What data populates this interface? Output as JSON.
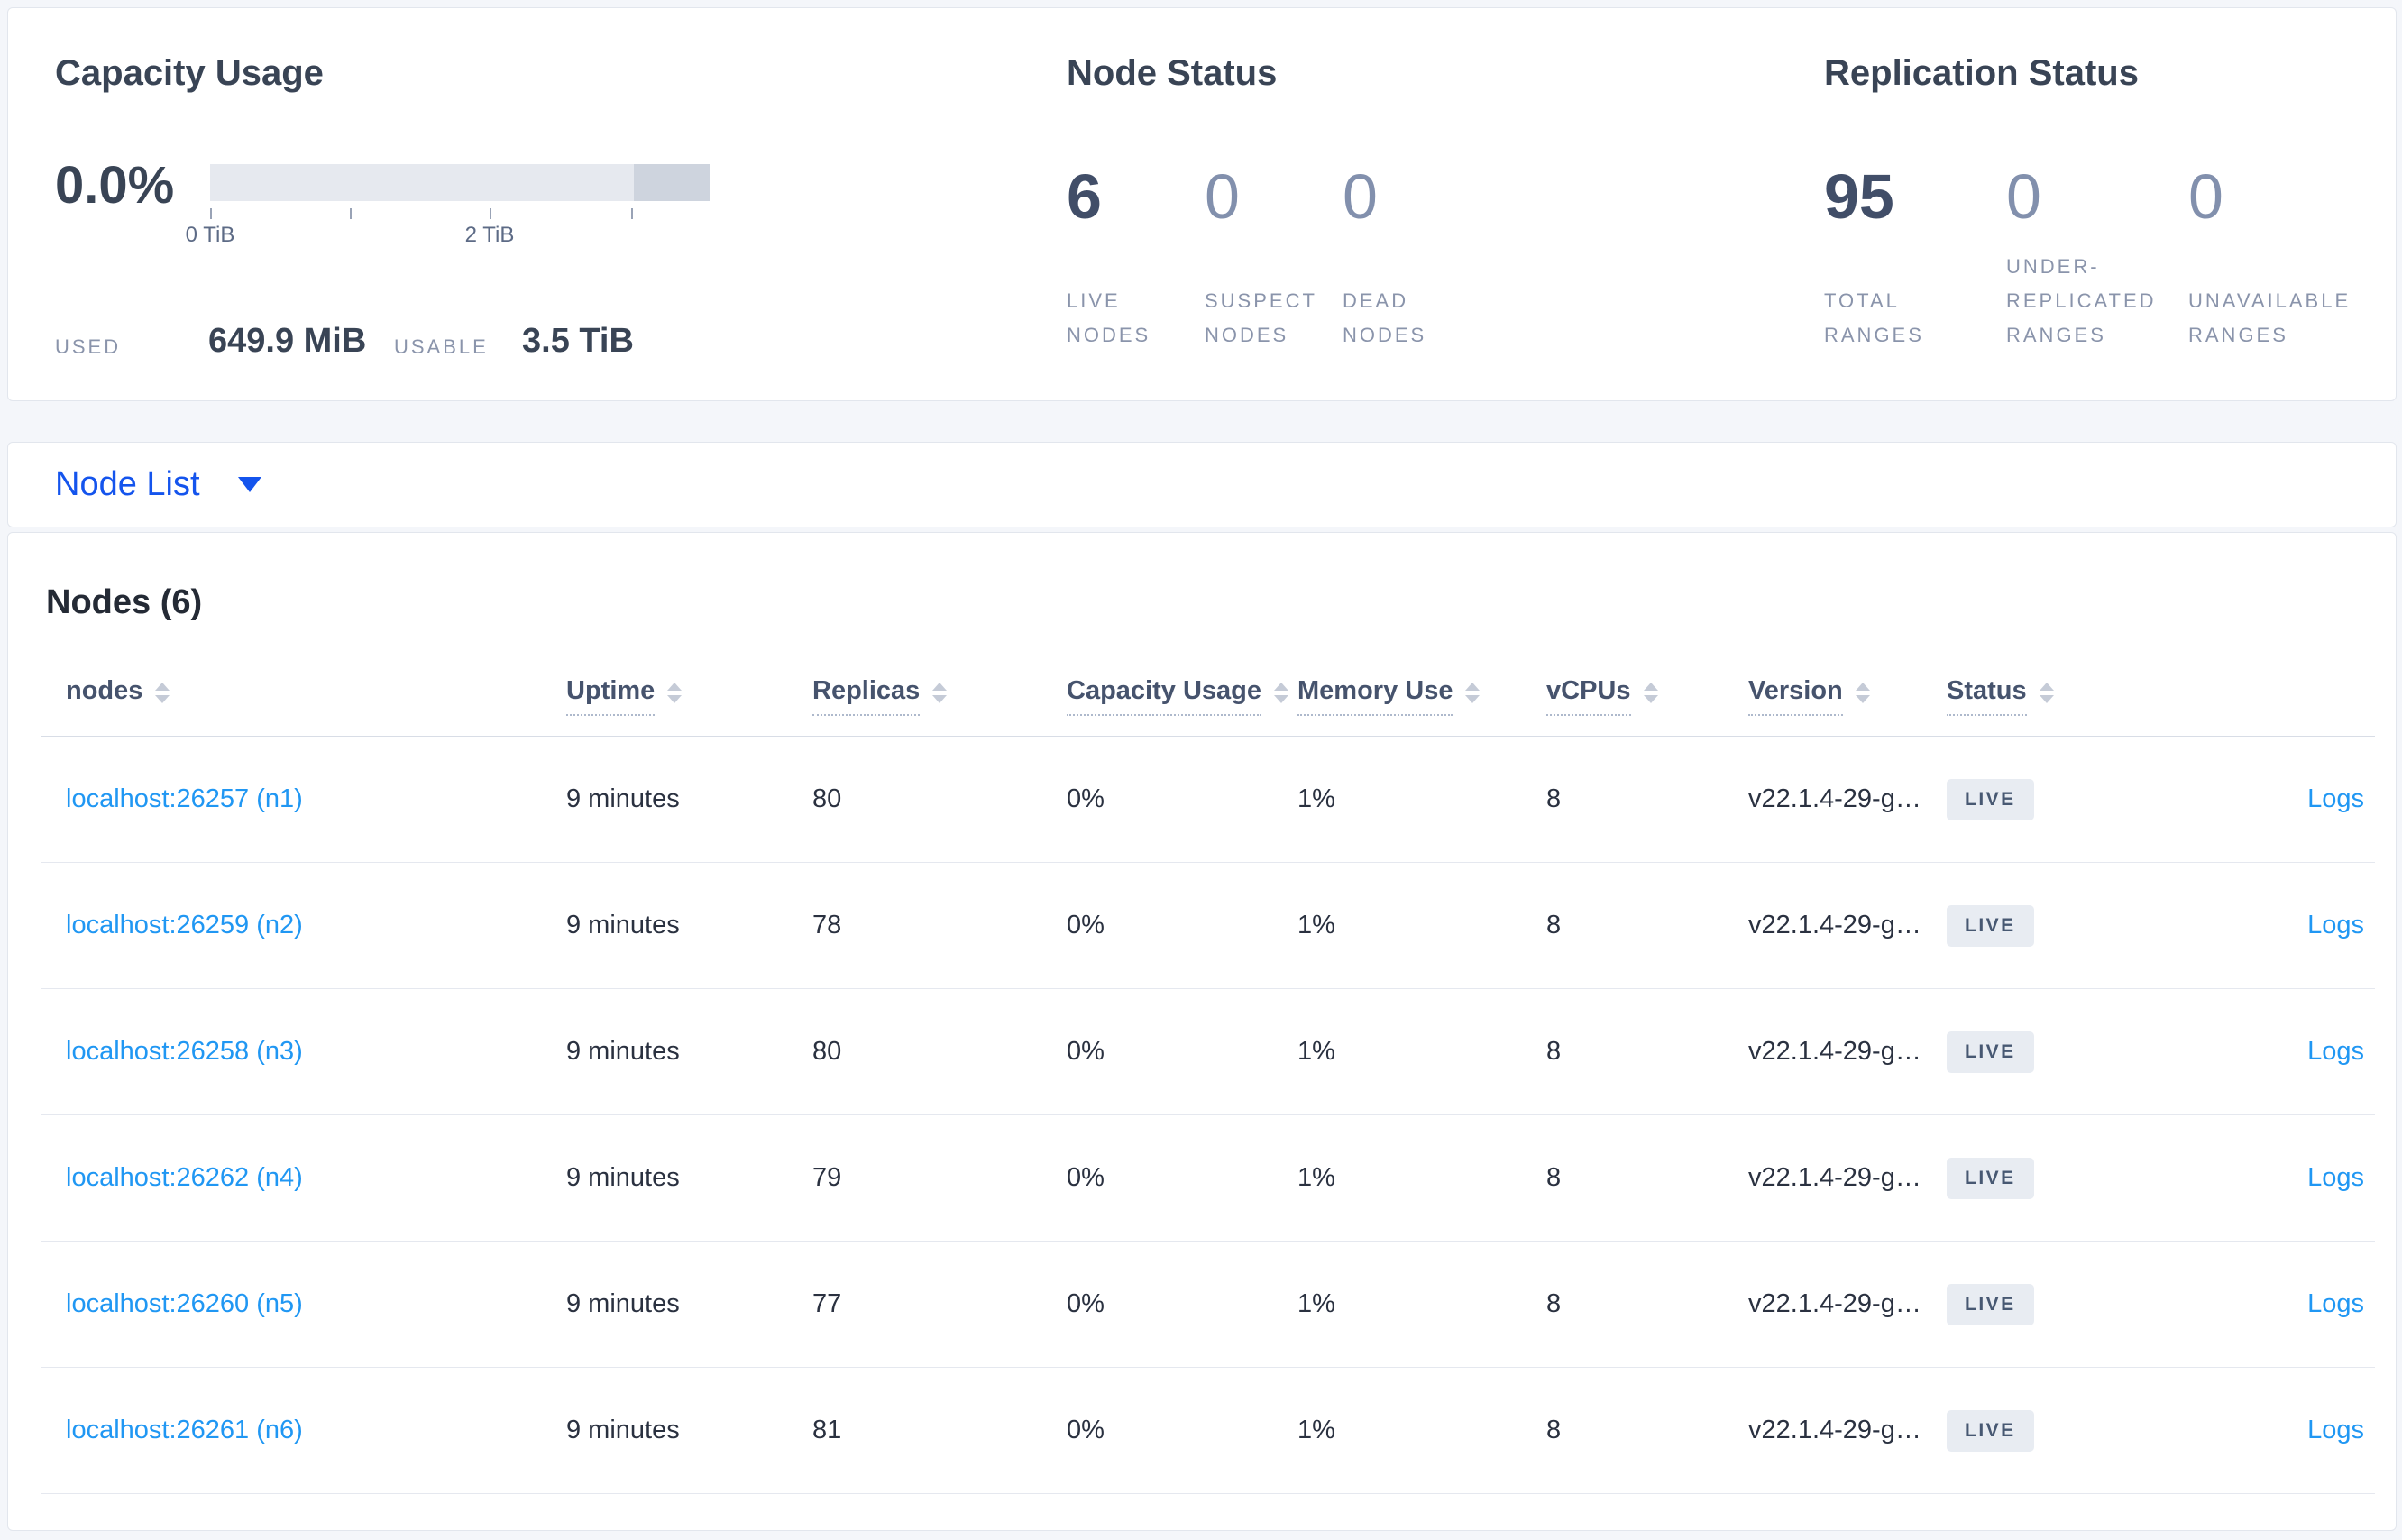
{
  "summary": {
    "capacity": {
      "title": "Capacity Usage",
      "percent": "0.0%",
      "axis_tick_labels": [
        "0 TiB",
        "",
        "2 TiB",
        ""
      ],
      "used_label": "USED",
      "used_value": "649.9 MiB",
      "usable_label": "USABLE",
      "usable_value": "3.5 TiB"
    },
    "node_status": {
      "title": "Node Status",
      "stats": [
        {
          "value": "6",
          "label": "LIVE NODES",
          "emphasis": "strong"
        },
        {
          "value": "0",
          "label": "SUSPECT NODES",
          "emphasis": "muted"
        },
        {
          "value": "0",
          "label": "DEAD NODES",
          "emphasis": "muted"
        }
      ]
    },
    "replication": {
      "title": "Replication Status",
      "stats": [
        {
          "value": "95",
          "label": "TOTAL RANGES",
          "emphasis": "strong"
        },
        {
          "value": "0",
          "label": "UNDER-REPLICATED RANGES",
          "emphasis": "muted"
        },
        {
          "value": "0",
          "label": "UNAVAILABLE RANGES",
          "emphasis": "muted"
        }
      ]
    }
  },
  "node_list_dropdown": {
    "label": "Node List"
  },
  "nodes_table": {
    "title": "Nodes (6)",
    "columns": [
      {
        "label": "nodes",
        "underline": false,
        "sortable": true
      },
      {
        "label": "Uptime",
        "underline": true,
        "sortable": true
      },
      {
        "label": "Replicas",
        "underline": true,
        "sortable": true
      },
      {
        "label": "Capacity Usage",
        "underline": true,
        "sortable": true
      },
      {
        "label": "Memory Use",
        "underline": true,
        "sortable": true
      },
      {
        "label": "vCPUs",
        "underline": true,
        "sortable": true
      },
      {
        "label": "Version",
        "underline": true,
        "sortable": true
      },
      {
        "label": "Status",
        "underline": true,
        "sortable": true
      },
      {
        "label": "",
        "underline": false,
        "sortable": false
      }
    ],
    "rows": [
      {
        "address": "localhost:26257 (n1)",
        "uptime": "9 minutes",
        "replicas": "80",
        "capacity_usage": "0%",
        "memory_use": "1%",
        "vcpus": "8",
        "version": "v22.1.4-29-g…",
        "status": "LIVE",
        "logs": "Logs"
      },
      {
        "address": "localhost:26259 (n2)",
        "uptime": "9 minutes",
        "replicas": "78",
        "capacity_usage": "0%",
        "memory_use": "1%",
        "vcpus": "8",
        "version": "v22.1.4-29-g…",
        "status": "LIVE",
        "logs": "Logs"
      },
      {
        "address": "localhost:26258 (n3)",
        "uptime": "9 minutes",
        "replicas": "80",
        "capacity_usage": "0%",
        "memory_use": "1%",
        "vcpus": "8",
        "version": "v22.1.4-29-g…",
        "status": "LIVE",
        "logs": "Logs"
      },
      {
        "address": "localhost:26262 (n4)",
        "uptime": "9 minutes",
        "replicas": "79",
        "capacity_usage": "0%",
        "memory_use": "1%",
        "vcpus": "8",
        "version": "v22.1.4-29-g…",
        "status": "LIVE",
        "logs": "Logs"
      },
      {
        "address": "localhost:26260 (n5)",
        "uptime": "9 minutes",
        "replicas": "77",
        "capacity_usage": "0%",
        "memory_use": "1%",
        "vcpus": "8",
        "version": "v22.1.4-29-g…",
        "status": "LIVE",
        "logs": "Logs"
      },
      {
        "address": "localhost:26261 (n6)",
        "uptime": "9 minutes",
        "replicas": "81",
        "capacity_usage": "0%",
        "memory_use": "1%",
        "vcpus": "8",
        "version": "v22.1.4-29-g…",
        "status": "LIVE",
        "logs": "Logs"
      }
    ]
  },
  "colors": {
    "page_background": "#f4f6fa",
    "card_border": "#e2e6ed",
    "heading_text": "#394455",
    "stat_strong": "#414e68",
    "stat_muted": "#8290ad",
    "uppercase_label": "#8a94ab",
    "nav_link_blue": "#1454ed",
    "link_blue": "#2097f3",
    "badge_background": "#e8ecf2",
    "badge_text": "#475872",
    "bar_track": "#e6e9ef",
    "bar_dark_segment": "#ced4de"
  }
}
